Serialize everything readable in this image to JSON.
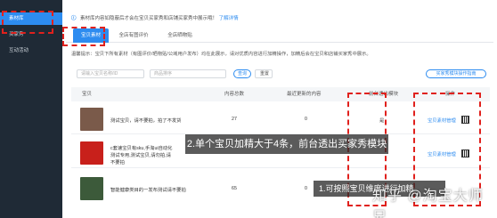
{
  "sidebar": {
    "items": [
      {
        "label": "素材库",
        "active": true
      },
      {
        "label": "买家秀",
        "active": false
      },
      {
        "label": "互动活动",
        "active": false
      }
    ]
  },
  "notice": {
    "text": "素材库内容如隐蔽后才会在宝贝买家秀和店铺买家秀中展示哦！",
    "link": "了解详情"
  },
  "tabs": [
    {
      "label": "宝贝素材",
      "active": true
    },
    {
      "label": "全店有图评价",
      "active": false
    },
    {
      "label": "全店晒物贴",
      "active": false
    }
  ],
  "hint": "温馨提示：宝贝下所有素材（有图评价/晒物贴/公域用户发布）均在此展示，请对优质内容进行加精操作，加精后会在宝贝和店铺买家秀中展示。",
  "filters": {
    "item_placeholder": "请输入宝贝名称/ID",
    "sort_placeholder": "商品排序",
    "search_label": "查询",
    "reset_label": "重置",
    "guide_label": "买家秀模块操作指南"
  },
  "table": {
    "headers": [
      "宝贝",
      "内容总数",
      "最近更新的内容",
      "前台透出模块",
      "操作"
    ],
    "rows": [
      {
        "title": "测试宝贝，请不要拍，拍了不发货",
        "count": "27",
        "recent": "0",
        "module": "是",
        "action": "宝贝素材管理",
        "thumb_color": "#7a5a4a"
      },
      {
        "title": "c套速宝贝有sku,手淘ui自动化测试专用,测试宝贝,请勿拍,请不要拍",
        "count": "",
        "recent": "",
        "module": "",
        "action": "宝贝素材管理",
        "thumb_color": "#c8201b"
      },
      {
        "title": "智能健康类目的一发布测试请不要拍",
        "count": "65",
        "recent": "0",
        "module": "",
        "action": "",
        "thumb_color": "#3c5a3a"
      }
    ]
  },
  "annotations": {
    "center": "2.单个宝贝加精大于4条，前台透出买家秀模块",
    "bottom": "1.可按照宝贝维度进行加精"
  },
  "watermark": "知乎 @淘宝大师兄",
  "colors": {
    "accent": "#2d8cf0",
    "annotation": "#e0211d",
    "sidebar": "#1f2a36"
  }
}
